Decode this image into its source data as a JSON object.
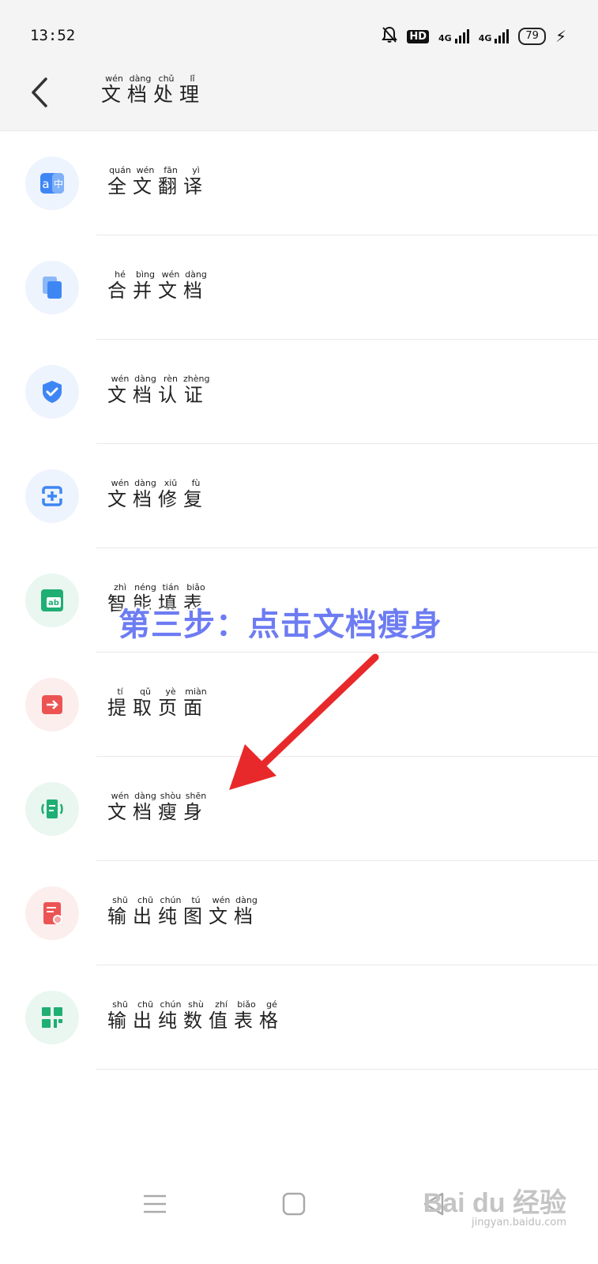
{
  "status_bar": {
    "time": "13:52",
    "hd_badge": "HD",
    "signal1_label": "4G",
    "signal2_label": "4G",
    "battery": "79",
    "icons": [
      "bell-mute-icon",
      "hd-icon",
      "signal-icon",
      "signal-icon",
      "battery-icon",
      "charging-icon"
    ]
  },
  "header": {
    "back_icon": "chevron-left-icon",
    "title_chars": [
      {
        "hz": "文",
        "py": "wén"
      },
      {
        "hz": "档",
        "py": "dàng"
      },
      {
        "hz": "处",
        "py": "chǔ"
      },
      {
        "hz": "理",
        "py": "lǐ"
      }
    ]
  },
  "items": [
    {
      "icon": "translate-icon",
      "color": "#3f86f5",
      "bg": "#eef4fd",
      "chars": [
        {
          "hz": "全",
          "py": "quán"
        },
        {
          "hz": "文",
          "py": "wén"
        },
        {
          "hz": "翻",
          "py": "fān"
        },
        {
          "hz": "译",
          "py": "yì"
        }
      ]
    },
    {
      "icon": "merge-docs-icon",
      "color": "#3f86f5",
      "bg": "#eef4fd",
      "chars": [
        {
          "hz": "合",
          "py": "hé"
        },
        {
          "hz": "并",
          "py": "bìng"
        },
        {
          "hz": "文",
          "py": "wén"
        },
        {
          "hz": "档",
          "py": "dàng"
        }
      ]
    },
    {
      "icon": "shield-check-icon",
      "color": "#3f86f5",
      "bg": "#eef4fd",
      "chars": [
        {
          "hz": "文",
          "py": "wén"
        },
        {
          "hz": "档",
          "py": "dàng"
        },
        {
          "hz": "认",
          "py": "rèn"
        },
        {
          "hz": "证",
          "py": "zhèng"
        }
      ]
    },
    {
      "icon": "repair-icon",
      "color": "#3f86f5",
      "bg": "#eef4fd",
      "chars": [
        {
          "hz": "文",
          "py": "wén"
        },
        {
          "hz": "档",
          "py": "dàng"
        },
        {
          "hz": "修",
          "py": "xiū"
        },
        {
          "hz": "复",
          "py": "fù"
        }
      ]
    },
    {
      "icon": "form-fill-icon",
      "color": "#1fae73",
      "bg": "#e9f7f0",
      "chars": [
        {
          "hz": "智",
          "py": "zhì"
        },
        {
          "hz": "能",
          "py": "néng"
        },
        {
          "hz": "填",
          "py": "tián"
        },
        {
          "hz": "表",
          "py": "biǎo"
        }
      ]
    },
    {
      "icon": "extract-page-icon",
      "color": "#ec5454",
      "bg": "#fdeeee",
      "chars": [
        {
          "hz": "提",
          "py": "tí"
        },
        {
          "hz": "取",
          "py": "qǔ"
        },
        {
          "hz": "页",
          "py": "yè"
        },
        {
          "hz": "面",
          "py": "miàn"
        }
      ]
    },
    {
      "icon": "slim-doc-icon",
      "color": "#1fae73",
      "bg": "#e9f7f0",
      "chars": [
        {
          "hz": "文",
          "py": "wén"
        },
        {
          "hz": "档",
          "py": "dàng"
        },
        {
          "hz": "瘦",
          "py": "shòu"
        },
        {
          "hz": "身",
          "py": "shēn"
        }
      ]
    },
    {
      "icon": "image-doc-icon",
      "color": "#ec5454",
      "bg": "#fdeeee",
      "chars": [
        {
          "hz": "输",
          "py": "shū"
        },
        {
          "hz": "出",
          "py": "chū"
        },
        {
          "hz": "纯",
          "py": "chún"
        },
        {
          "hz": "图",
          "py": "tú"
        },
        {
          "hz": "文",
          "py": "wén"
        },
        {
          "hz": "档",
          "py": "dàng"
        }
      ]
    },
    {
      "icon": "spreadsheet-icon",
      "color": "#1fae73",
      "bg": "#e9f7f0",
      "chars": [
        {
          "hz": "输",
          "py": "shū"
        },
        {
          "hz": "出",
          "py": "chū"
        },
        {
          "hz": "纯",
          "py": "chún"
        },
        {
          "hz": "数",
          "py": "shù"
        },
        {
          "hz": "值",
          "py": "zhí"
        },
        {
          "hz": "表",
          "py": "biǎo"
        },
        {
          "hz": "格",
          "py": "gé"
        }
      ]
    }
  ],
  "overlay": {
    "step_text": "第三步：点击文档瘦身",
    "step_color": "#6d7cf2",
    "arrow_color": "#e8292b"
  },
  "navbar": {
    "icons": [
      "menu-icon",
      "home-square-icon",
      "back-triangle-icon"
    ]
  },
  "watermark": {
    "logo_text": "Bai du 经验",
    "url": "jingyan.baidu.com"
  }
}
